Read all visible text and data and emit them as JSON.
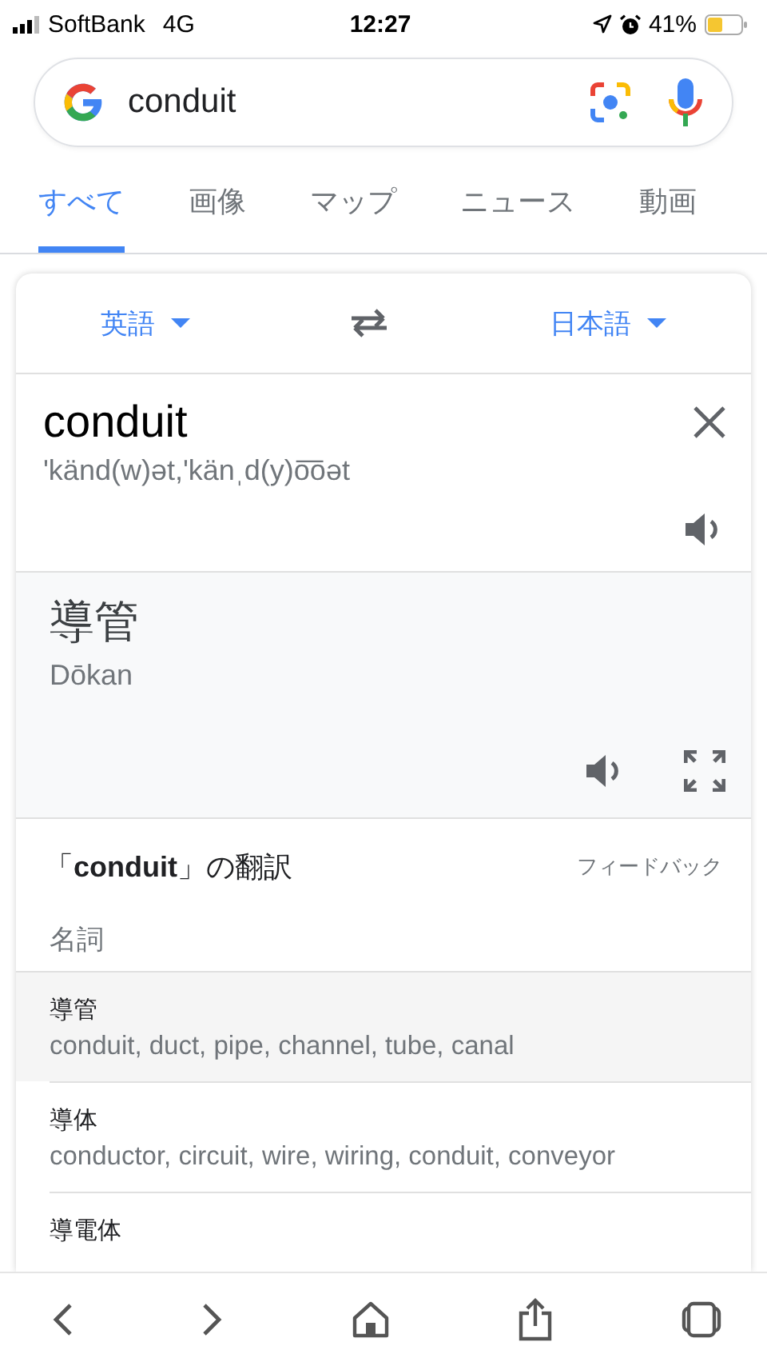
{
  "status_bar": {
    "carrier": "SoftBank",
    "network": "4G",
    "time": "12:27",
    "battery": "41%"
  },
  "search": {
    "value": "conduit"
  },
  "tabs": [
    {
      "label": "すべて",
      "selected": true
    },
    {
      "label": "画像",
      "selected": false
    },
    {
      "label": "マップ",
      "selected": false
    },
    {
      "label": "ニュース",
      "selected": false
    },
    {
      "label": "動画",
      "selected": false
    }
  ],
  "translator": {
    "source_language": "英語",
    "target_language": "日本語",
    "source_text": "conduit",
    "pronunciation": "'känd(w)ət,'känˌd(y)o͞oət",
    "translation": "導管",
    "romanization": "Dōkan"
  },
  "dictionary": {
    "title": "「**conduit**」の翻訳",
    "feedback": "フィードバック",
    "part_of_speech": "名詞",
    "entries": [
      {
        "term": "導管",
        "synonyms": "conduit, duct, pipe, channel, tube, canal",
        "selected": true
      },
      {
        "term": "導体",
        "synonyms": "conductor, circuit, wire, wiring, conduit, conveyor",
        "selected": false
      },
      {
        "term": "導電体",
        "selected": false
      }
    ]
  }
}
